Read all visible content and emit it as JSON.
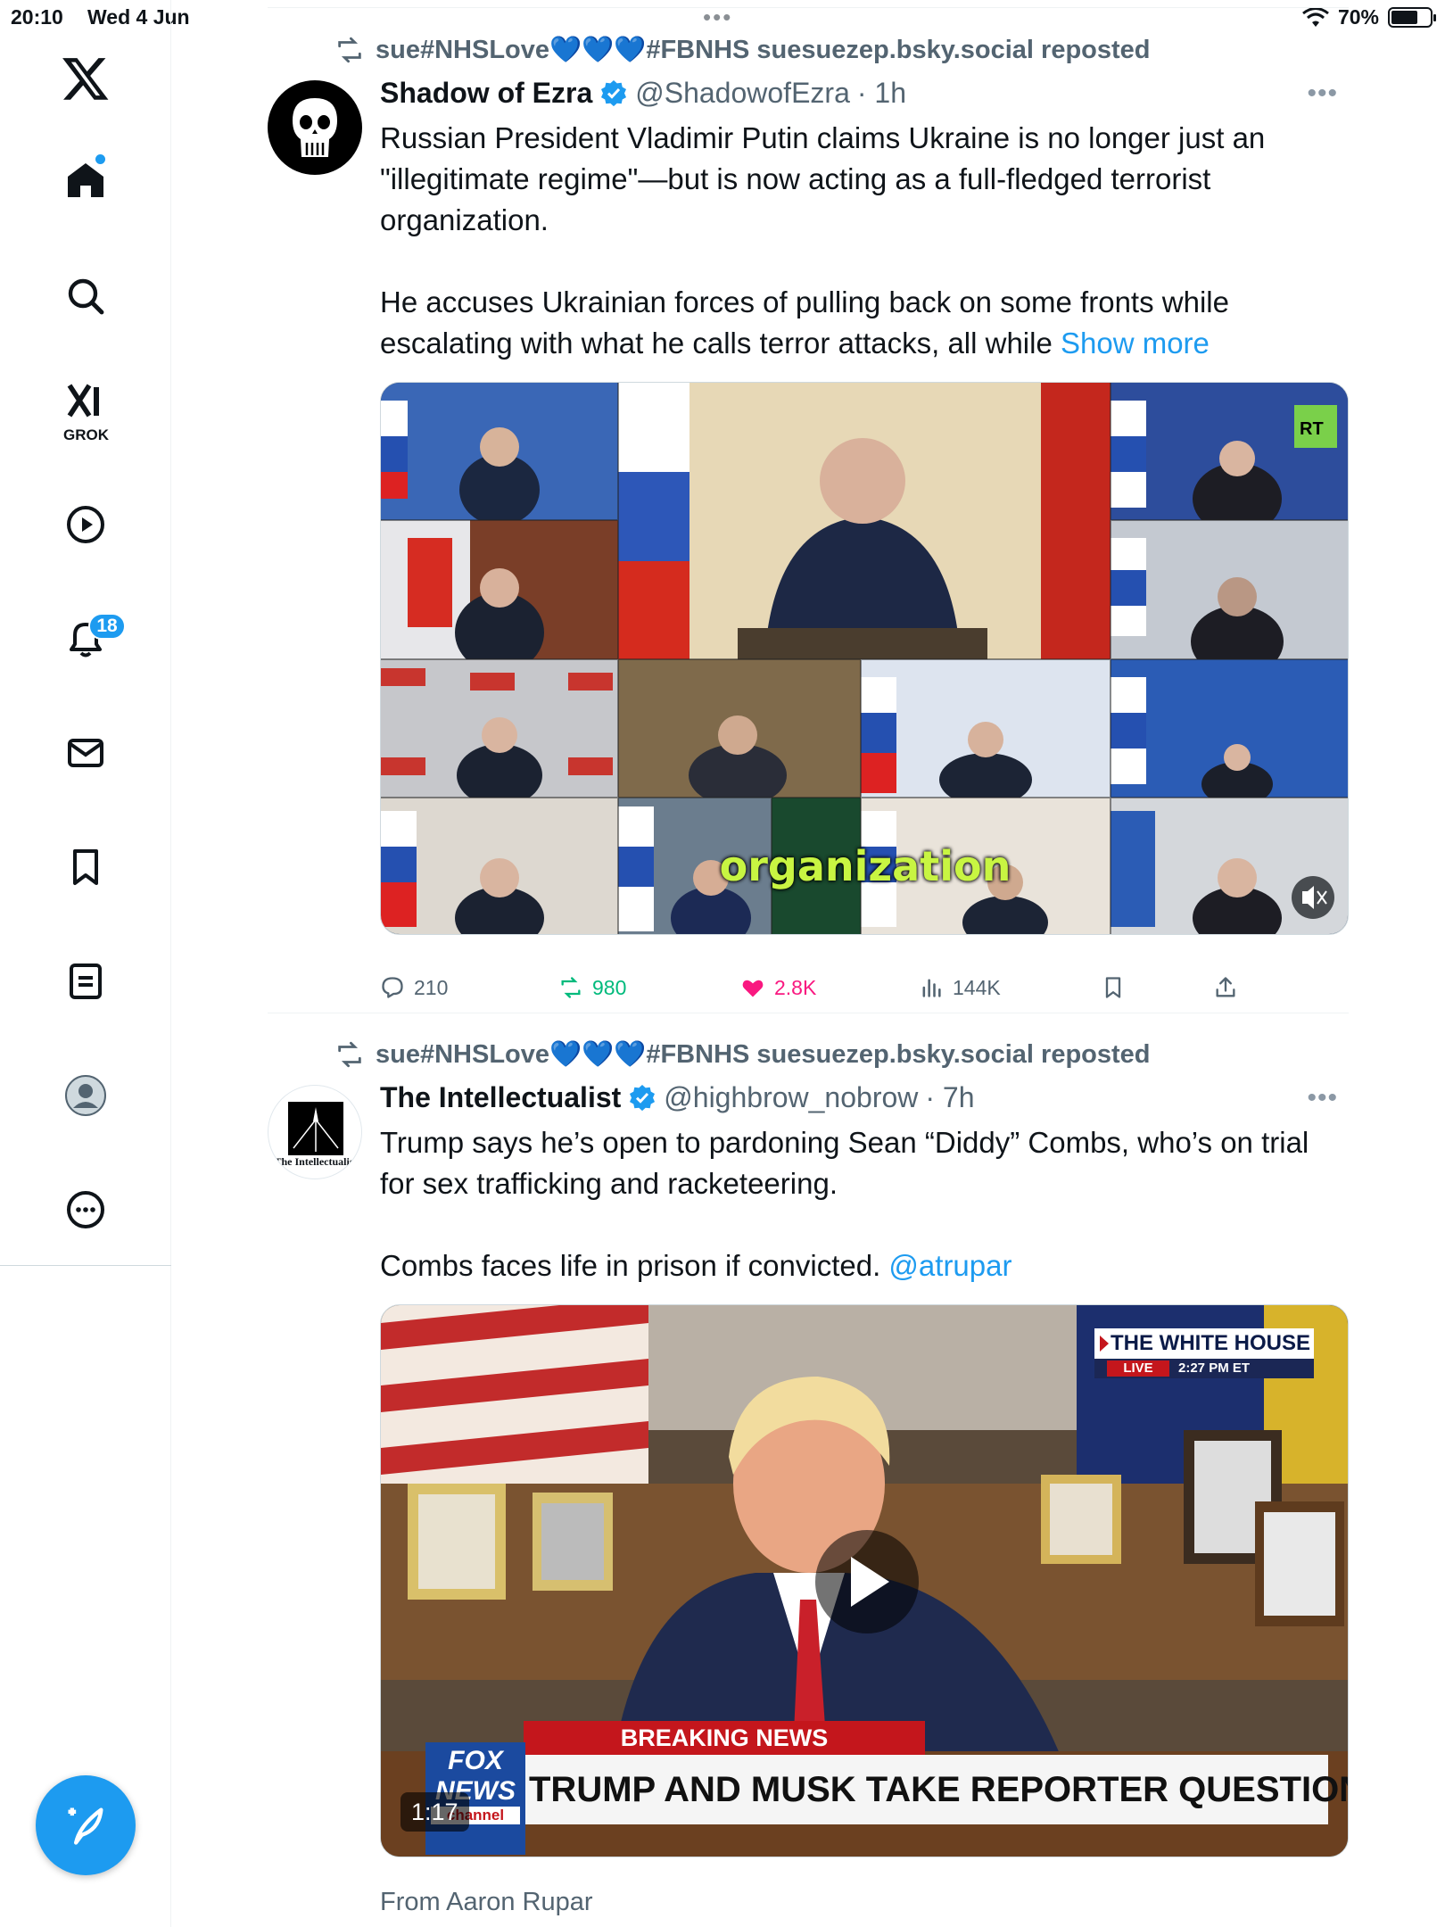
{
  "status_bar": {
    "time": "20:10",
    "date": "Wed 4 Jun",
    "battery_text": "70%",
    "battery_level": 0.7
  },
  "sidebar": {
    "grok_label": "GROK",
    "notification_count": "18",
    "items": [
      "x-logo",
      "home-icon",
      "search-icon",
      "grok-icon",
      "video-icon",
      "notifications-icon",
      "messages-icon",
      "bookmarks-icon",
      "lists-icon",
      "profile-icon",
      "more-icon"
    ]
  },
  "posts": [
    {
      "repost_by": "sue#NHSLove💙💙💙#FBNHS suesuezep.bsky.social reposted",
      "author": "Shadow of Ezra",
      "handle": "@ShadowofEzra",
      "time": "· 1h",
      "text_p1": "Russian President Vladimir Putin claims Ukraine is no longer just an \"illegitimate regime\"—but is now acting as a full-fledged terrorist organization.",
      "text_p2": "He accuses Ukrainian forces of pulling back on some fronts while escalating with what he calls terror attacks, all while",
      "show_more": "Show more",
      "video_caption": "organization",
      "video_badge": "RT",
      "replies": "210",
      "reposts": "980",
      "likes": "2.8K",
      "views": "144K"
    },
    {
      "repost_by": "sue#NHSLove💙💙💙#FBNHS suesuezep.bsky.social reposted",
      "author": "The Intellectualist",
      "handle": "@highbrow_nobrow",
      "time": "· 7h",
      "avatar_text": "The Intellectualist",
      "text_p1": "Trump says he’s open to pardoning Sean “Diddy” Combs, who’s on trial for sex trafficking and racketeering.",
      "text_p2": "Combs faces life in prison if convicted.",
      "mention": "@atrupar",
      "video_duration": "1:17",
      "tv_top_banner": "THE WHITE HOUSE",
      "tv_live": "LIVE",
      "tv_time": "2:27 PM ET",
      "tv_breaking": "BREAKING NEWS",
      "tv_headline": "TRUMP AND MUSK TAKE REPORTER QUESTIONS",
      "tv_logo_1": "FOX",
      "tv_logo_2": "NEWS",
      "tv_logo_3": "channel",
      "from_line": "From Aaron Rupar"
    }
  ],
  "colors": {
    "accent": "#1d9bf0",
    "like": "#f91880",
    "repost": "#00ba7c",
    "muted_text": "#536471"
  }
}
